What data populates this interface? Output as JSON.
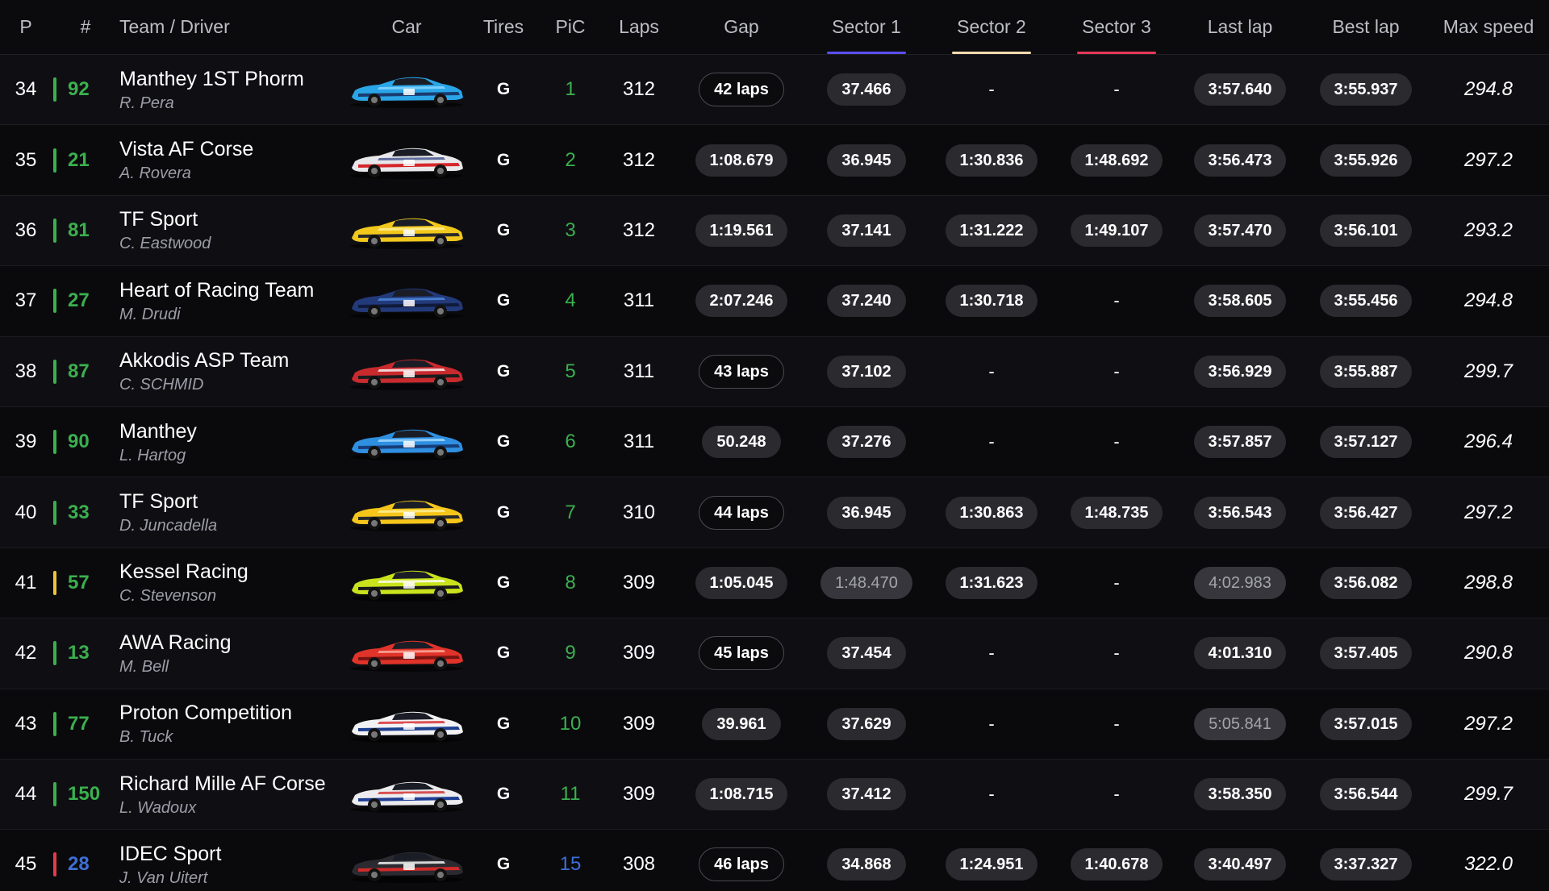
{
  "headers": {
    "p": "P",
    "num": "#",
    "team": "Team / Driver",
    "car": "Car",
    "tires": "Tires",
    "pic": "PiC",
    "laps": "Laps",
    "gap": "Gap",
    "s1": "Sector 1",
    "s2": "Sector 2",
    "s3": "Sector 3",
    "last": "Last lap",
    "best": "Best lap",
    "max": "Max speed"
  },
  "colors": {
    "sector1": "#5b4ff0",
    "sector2": "#f1dcae",
    "sector3": "#e5385a",
    "class_green": "#3bb04e",
    "class_yellow": "#f0c23a",
    "class_red": "#e23c48",
    "class_blue": "#3d6fd6"
  },
  "rows": [
    {
      "p": "34",
      "num": "92",
      "team": "Manthey 1ST Phorm",
      "driver": "R. Pera",
      "tires": "G",
      "pic": "1",
      "laps": "312",
      "gap": "42 laps",
      "gapStyle": "outline",
      "s1": "37.466",
      "s1Style": "normal",
      "s2": "-",
      "s2Style": "normal",
      "s3": "-",
      "s3Style": "normal",
      "last": "3:57.640",
      "lastStyle": "normal",
      "best": "3:55.937",
      "max": "294.8",
      "cls": "green",
      "car": {
        "body": "#2aa6e8",
        "accent": "#1a3b6e",
        "stripe": "#8fd8ff"
      }
    },
    {
      "p": "35",
      "num": "21",
      "team": "Vista AF Corse",
      "driver": "A. Rovera",
      "tires": "G",
      "pic": "2",
      "laps": "312",
      "gap": "1:08.679",
      "gapStyle": "normal",
      "s1": "36.945",
      "s1Style": "normal",
      "s2": "1:30.836",
      "s2Style": "normal",
      "s3": "1:48.692",
      "s3Style": "normal",
      "last": "3:56.473",
      "lastStyle": "normal",
      "best": "3:55.926",
      "max": "297.2",
      "cls": "green",
      "car": {
        "body": "#e8e8ea",
        "accent": "#d6262a",
        "stripe": "#3b4c8a"
      }
    },
    {
      "p": "36",
      "num": "81",
      "team": "TF Sport",
      "driver": "C. Eastwood",
      "tires": "G",
      "pic": "3",
      "laps": "312",
      "gap": "1:19.561",
      "gapStyle": "normal",
      "s1": "37.141",
      "s1Style": "normal",
      "s2": "1:31.222",
      "s2Style": "normal",
      "s3": "1:49.107",
      "s3Style": "normal",
      "last": "3:57.470",
      "lastStyle": "normal",
      "best": "3:56.101",
      "max": "293.2",
      "cls": "green",
      "car": {
        "body": "#f2c81c",
        "accent": "#2b2b2b",
        "stripe": "#fff1a0"
      }
    },
    {
      "p": "37",
      "num": "27",
      "team": "Heart of Racing Team",
      "driver": "M. Drudi",
      "tires": "G",
      "pic": "4",
      "laps": "311",
      "gap": "2:07.246",
      "gapStyle": "normal",
      "s1": "37.240",
      "s1Style": "normal",
      "s2": "1:30.718",
      "s2Style": "normal",
      "s3": "-",
      "s3Style": "normal",
      "last": "3:58.605",
      "lastStyle": "normal",
      "best": "3:55.456",
      "max": "294.8",
      "cls": "green",
      "car": {
        "body": "#233a7a",
        "accent": "#101a3a",
        "stripe": "#4f8de0"
      }
    },
    {
      "p": "38",
      "num": "87",
      "team": "Akkodis ASP Team",
      "driver": "C. SCHMID",
      "tires": "G",
      "pic": "5",
      "laps": "311",
      "gap": "43 laps",
      "gapStyle": "outline",
      "s1": "37.102",
      "s1Style": "normal",
      "s2": "-",
      "s2Style": "normal",
      "s3": "-",
      "s3Style": "normal",
      "last": "3:56.929",
      "lastStyle": "normal",
      "best": "3:55.887",
      "max": "299.7",
      "cls": "green",
      "car": {
        "body": "#c92a2e",
        "accent": "#1c1c1c",
        "stripe": "#ffffff"
      }
    },
    {
      "p": "39",
      "num": "90",
      "team": "Manthey",
      "driver": "L. Hartog",
      "tires": "G",
      "pic": "6",
      "laps": "311",
      "gap": "50.248",
      "gapStyle": "normal",
      "s1": "37.276",
      "s1Style": "normal",
      "s2": "-",
      "s2Style": "normal",
      "s3": "-",
      "s3Style": "normal",
      "last": "3:57.857",
      "lastStyle": "normal",
      "best": "3:57.127",
      "max": "296.4",
      "cls": "green",
      "car": {
        "body": "#2f8fe0",
        "accent": "#163e7a",
        "stripe": "#a7ddff"
      }
    },
    {
      "p": "40",
      "num": "33",
      "team": "TF Sport",
      "driver": "D. Juncadella",
      "tires": "G",
      "pic": "7",
      "laps": "310",
      "gap": "44 laps",
      "gapStyle": "outline",
      "s1": "36.945",
      "s1Style": "normal",
      "s2": "1:30.863",
      "s2Style": "normal",
      "s3": "1:48.735",
      "s3Style": "normal",
      "last": "3:56.543",
      "lastStyle": "normal",
      "best": "3:56.427",
      "max": "297.2",
      "cls": "green",
      "car": {
        "body": "#f5c51a",
        "accent": "#2b2b2b",
        "stripe": "#fff1a0"
      }
    },
    {
      "p": "41",
      "num": "57",
      "team": "Kessel Racing",
      "driver": "C. Stevenson",
      "tires": "G",
      "pic": "8",
      "laps": "309",
      "gap": "1:05.045",
      "gapStyle": "normal",
      "s1": "1:48.470",
      "s1Style": "dim",
      "s2": "1:31.623",
      "s2Style": "normal",
      "s3": "-",
      "s3Style": "normal",
      "last": "4:02.983",
      "lastStyle": "dim",
      "best": "3:56.082",
      "max": "298.8",
      "cls": "yellow",
      "car": {
        "body": "#c9e21c",
        "accent": "#1c1c1c",
        "stripe": "#ffffff"
      }
    },
    {
      "p": "42",
      "num": "13",
      "team": "AWA Racing",
      "driver": "M. Bell",
      "tires": "G",
      "pic": "9",
      "laps": "309",
      "gap": "45 laps",
      "gapStyle": "outline",
      "s1": "37.454",
      "s1Style": "normal",
      "s2": "-",
      "s2Style": "normal",
      "s3": "-",
      "s3Style": "normal",
      "last": "4:01.310",
      "lastStyle": "normal",
      "best": "3:57.405",
      "max": "290.8",
      "cls": "green",
      "car": {
        "body": "#e0332a",
        "accent": "#7a1410",
        "stripe": "#ffb0a0"
      }
    },
    {
      "p": "43",
      "num": "77",
      "team": "Proton Competition",
      "driver": "B. Tuck",
      "tires": "G",
      "pic": "10",
      "laps": "309",
      "gap": "39.961",
      "gapStyle": "normal",
      "s1": "37.629",
      "s1Style": "normal",
      "s2": "-",
      "s2Style": "normal",
      "s3": "-",
      "s3Style": "normal",
      "last": "5:05.841",
      "lastStyle": "dim",
      "best": "3:57.015",
      "max": "297.2",
      "cls": "green",
      "car": {
        "body": "#f2f2f4",
        "accent": "#1d3f8f",
        "stripe": "#d6262a"
      }
    },
    {
      "p": "44",
      "num": "150",
      "team": "Richard Mille AF Corse",
      "driver": "L. Wadoux",
      "tires": "G",
      "pic": "11",
      "laps": "309",
      "gap": "1:08.715",
      "gapStyle": "normal",
      "s1": "37.412",
      "s1Style": "normal",
      "s2": "-",
      "s2Style": "normal",
      "s3": "-",
      "s3Style": "normal",
      "last": "3:58.350",
      "lastStyle": "normal",
      "best": "3:56.544",
      "max": "299.7",
      "cls": "green",
      "car": {
        "body": "#ececef",
        "accent": "#1f3f95",
        "stripe": "#d22a2a"
      }
    },
    {
      "p": "45",
      "num": "28",
      "team": "IDEC Sport",
      "driver": "J. Van Uitert",
      "tires": "G",
      "pic": "15",
      "laps": "308",
      "gap": "46 laps",
      "gapStyle": "outline",
      "s1": "34.868",
      "s1Style": "normal",
      "s2": "1:24.951",
      "s2Style": "normal",
      "s3": "1:40.678",
      "s3Style": "normal",
      "last": "3:40.497",
      "lastStyle": "normal",
      "best": "3:37.327",
      "max": "322.0",
      "cls": "red",
      "car": {
        "body": "#2a2a30",
        "accent": "#d22a2a",
        "stripe": "#ffffff"
      }
    }
  ]
}
